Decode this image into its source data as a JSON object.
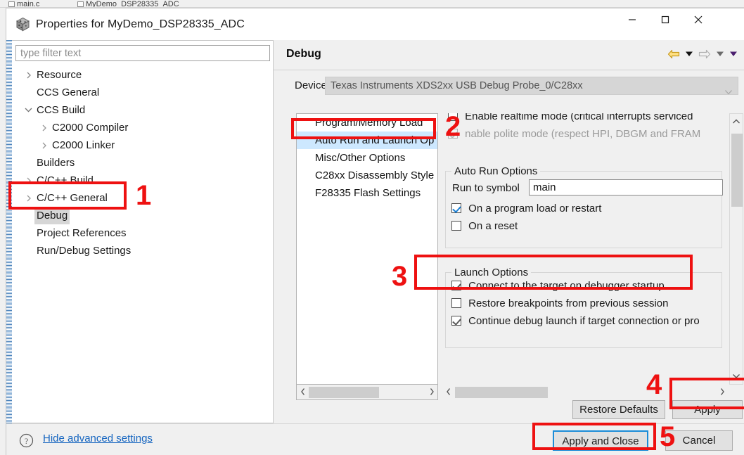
{
  "background_window": {
    "tabs": [
      {
        "label": "main.c"
      },
      {
        "label": "MyDemo_DSP28335_ADC"
      }
    ]
  },
  "window": {
    "title": "Properties for MyDemo_DSP28335_ADC",
    "icon": "properties-cube-icon",
    "controls": {
      "minimize": "minimize-icon",
      "maximize": "maximize-icon",
      "close": "close-icon"
    }
  },
  "sidebar": {
    "filter": {
      "placeholder": "type filter text",
      "value": ""
    },
    "items": [
      {
        "label": "Resource",
        "indent": 14,
        "arrow": "collapsed",
        "selected": false
      },
      {
        "label": "CCS General",
        "indent": 32,
        "arrow": "none",
        "selected": false
      },
      {
        "label": "CCS Build",
        "indent": 14,
        "arrow": "expanded",
        "selected": false
      },
      {
        "label": "C2000 Compiler",
        "indent": 36,
        "arrow": "collapsed",
        "selected": false
      },
      {
        "label": "C2000 Linker",
        "indent": 36,
        "arrow": "collapsed",
        "selected": false
      },
      {
        "label": "Builders",
        "indent": 32,
        "arrow": "none",
        "selected": false
      },
      {
        "label": "C/C++ Build",
        "indent": 14,
        "arrow": "collapsed",
        "selected": false
      },
      {
        "label": "C/C++ General",
        "indent": 14,
        "arrow": "collapsed",
        "selected": false
      },
      {
        "label": "Debug",
        "indent": 32,
        "arrow": "none",
        "selected": true
      },
      {
        "label": "Project References",
        "indent": 32,
        "arrow": "none",
        "selected": false
      },
      {
        "label": "Run/Debug Settings",
        "indent": 32,
        "arrow": "none",
        "selected": false
      }
    ]
  },
  "content": {
    "title": "Debug",
    "nav": {
      "back_icon": "back-arrow-icon",
      "back_menu_icon": "chevron-down-icon",
      "forward_icon": "forward-arrow-icon",
      "forward_menu_icon": "chevron-down-icon",
      "more_menu_icon": "chevron-down-icon"
    },
    "device": {
      "label": "Device",
      "value": "Texas Instruments XDS2xx USB Debug Probe_0/C28xx",
      "dropdown_icon": "chevron-down-icon",
      "disabled": true
    },
    "categories": [
      {
        "label": "Program/Memory Load",
        "selected": false
      },
      {
        "label": "Auto Run and Launch Op",
        "selected": true
      },
      {
        "label": "Misc/Other Options",
        "selected": false
      },
      {
        "label": "C28xx Disassembly Style",
        "selected": false
      },
      {
        "label": "F28335 Flash Settings",
        "selected": false
      }
    ],
    "top_checkboxes": [
      {
        "label": "Enable realtime mode (critical interrupts serviced",
        "checked": false,
        "disabled": false
      },
      {
        "label": "nable polite mode (respect HPI, DBGM and FRAM",
        "checked": true,
        "disabled": true
      }
    ],
    "auto_run_group": {
      "title": "Auto Run Options",
      "run_to_symbol": {
        "label": "Run to symbol",
        "value": "main"
      },
      "checkboxes": [
        {
          "label": "On a program load or restart",
          "checked": true
        },
        {
          "label": "On a reset",
          "checked": false
        }
      ]
    },
    "launch_group": {
      "title": "Launch Options",
      "checkboxes": [
        {
          "label": "Connect to the target on debugger startup",
          "checked": true
        },
        {
          "label": "Restore breakpoints from previous session",
          "checked": false
        },
        {
          "label": "Continue debug launch if target connection or pro",
          "checked": true
        }
      ]
    },
    "buttons": {
      "restore_defaults": "Restore Defaults",
      "apply": "Apply"
    },
    "scrollbars": {
      "left_arrow_icon": "chevron-left-icon",
      "right_arrow_icon": "chevron-right-icon",
      "up_arrow_icon": "chevron-up-icon",
      "down_arrow_icon": "chevron-down-icon"
    }
  },
  "footer": {
    "help_icon": "question-mark-icon",
    "hide_advanced": "Hide advanced settings",
    "apply_and_close": "Apply and Close",
    "cancel": "Cancel"
  },
  "annotations": {
    "color": "#ee1111",
    "markers": [
      {
        "number": "1",
        "target": "sidebar-item-debug"
      },
      {
        "number": "2",
        "target": "category-auto-run-and-launch"
      },
      {
        "number": "3",
        "target": "connect-to-target-checkbox"
      },
      {
        "number": "4",
        "target": "apply-button"
      },
      {
        "number": "5",
        "target": "apply-and-close-button"
      }
    ]
  }
}
